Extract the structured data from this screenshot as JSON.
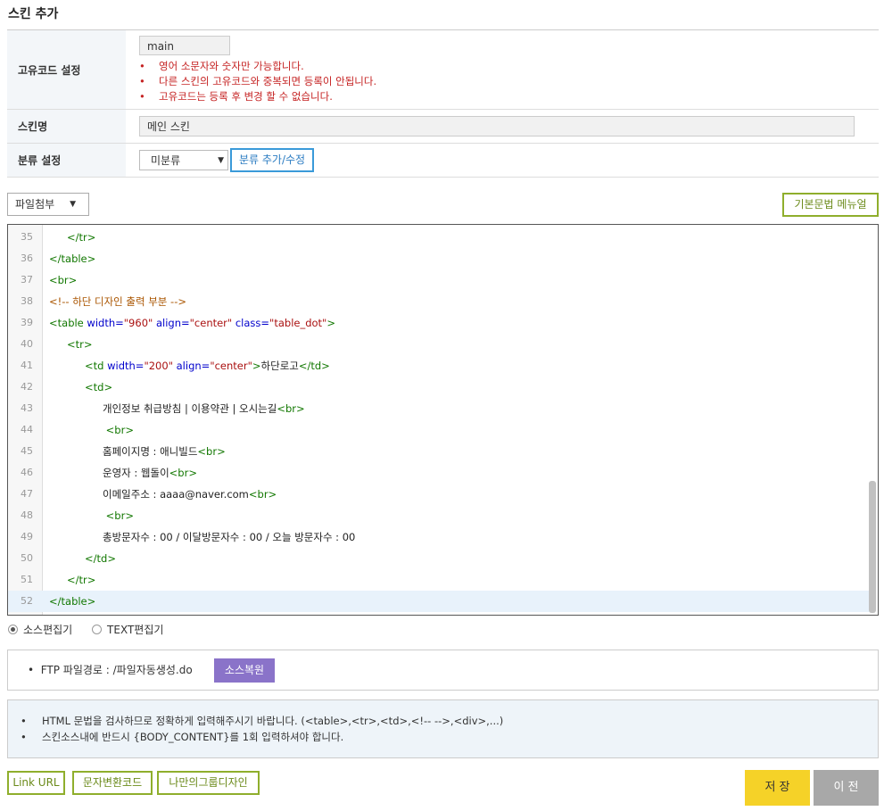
{
  "page_title": "스킨 추가",
  "form": {
    "code_label": "고유코드 설정",
    "code_value": "main",
    "code_notes": [
      "영어 소문자와 숫자만 가능합니다.",
      "다른 스킨의 고유코드와 중복되면 등록이 안됩니다.",
      "고유코드는 등록 후 변경 할 수 없습니다."
    ],
    "name_label": "스킨명",
    "name_value": "메인 스킨",
    "category_label": "분류 설정",
    "category_selected": "미분류",
    "category_button": "분류 추가/수정"
  },
  "toolbar": {
    "attach_label": "파일첨부",
    "manual_button": "기본문법 메뉴얼"
  },
  "editor": {
    "lines": [
      {
        "n": "35",
        "indent": 1,
        "segs": [
          [
            "tg",
            "</tr>"
          ]
        ]
      },
      {
        "n": "36",
        "indent": 0,
        "segs": [
          [
            "tg",
            "</table>"
          ]
        ]
      },
      {
        "n": "37",
        "indent": 0,
        "segs": [
          [
            "tg",
            "<br>"
          ]
        ]
      },
      {
        "n": "38",
        "indent": 0,
        "segs": [
          [
            "cm",
            "<!-- 하단 디자인 출력 부분 -->"
          ]
        ]
      },
      {
        "n": "39",
        "indent": 0,
        "segs": [
          [
            "tg",
            "<table "
          ],
          [
            "at",
            "width="
          ],
          [
            "sv",
            "\"960\""
          ],
          [
            "at",
            " align="
          ],
          [
            "sv",
            "\"center\""
          ],
          [
            "at",
            " class="
          ],
          [
            "sv",
            "\"table_dot\""
          ],
          [
            "tg",
            ">"
          ]
        ]
      },
      {
        "n": "40",
        "indent": 1,
        "segs": [
          [
            "tg",
            "<tr>"
          ]
        ]
      },
      {
        "n": "41",
        "indent": 2,
        "segs": [
          [
            "tg",
            "<td "
          ],
          [
            "at",
            "width="
          ],
          [
            "sv",
            "\"200\""
          ],
          [
            "at",
            " align="
          ],
          [
            "sv",
            "\"center\""
          ],
          [
            "tg",
            ">"
          ],
          [
            "tx",
            "하단로고"
          ],
          [
            "tg",
            "</td>"
          ]
        ]
      },
      {
        "n": "42",
        "indent": 2,
        "segs": [
          [
            "tg",
            "<td>"
          ]
        ]
      },
      {
        "n": "43",
        "indent": 3,
        "segs": [
          [
            "tx",
            "개인정보 취급방침 | 이용약관 | 오시는길"
          ],
          [
            "tg",
            "<br>"
          ]
        ]
      },
      {
        "n": "44",
        "indent": 3,
        "segs": [
          [
            "tx",
            " "
          ],
          [
            "tg",
            "<br>"
          ]
        ]
      },
      {
        "n": "45",
        "indent": 3,
        "segs": [
          [
            "tx",
            "홈페이지명 : 애니빌드"
          ],
          [
            "tg",
            "<br>"
          ]
        ]
      },
      {
        "n": "46",
        "indent": 3,
        "segs": [
          [
            "tx",
            "운영자 : 웹돌이"
          ],
          [
            "tg",
            "<br>"
          ]
        ]
      },
      {
        "n": "47",
        "indent": 3,
        "segs": [
          [
            "tx",
            "이메일주소 : aaaa@naver.com"
          ],
          [
            "tg",
            "<br>"
          ]
        ]
      },
      {
        "n": "48",
        "indent": 3,
        "segs": [
          [
            "tx",
            " "
          ],
          [
            "tg",
            "<br>"
          ]
        ]
      },
      {
        "n": "49",
        "indent": 3,
        "segs": [
          [
            "tx",
            "총방문자수 : 00 / 이달방문자수 : 00 / 오늘 방문자수 : 00"
          ]
        ]
      },
      {
        "n": "50",
        "indent": 2,
        "segs": [
          [
            "tg",
            "</td>"
          ]
        ]
      },
      {
        "n": "51",
        "indent": 1,
        "segs": [
          [
            "tg",
            "</tr>"
          ]
        ]
      },
      {
        "n": "52",
        "indent": 0,
        "segs": [
          [
            "tg",
            "</table>"
          ]
        ],
        "active": true
      }
    ]
  },
  "editor_mode": {
    "source_label": "소스편집기",
    "text_label": "TEXT편집기",
    "selected": "source"
  },
  "ftp": {
    "path_text": "FTP 파일경로 : /파일자동생성.do",
    "restore_button": "소스복원"
  },
  "info": [
    "HTML 문법을 검사하므로 정확하게 입력해주시기 바랍니다. (<table>,<tr>,<td>,<!-- -->,<div>,...)",
    "스킨소스내에 반드시 {BODY_CONTENT}를 1회 입력하셔야 합니다."
  ],
  "bottom": {
    "link_url": "Link URL",
    "char_convert": "문자변환코드",
    "group_design": "나만의그룹디자인",
    "save": "저 장",
    "prev": "이 전"
  },
  "colors": {
    "accent_blue": "#3a9ad9",
    "accent_green": "#8fae2c",
    "save_yellow": "#f5d228",
    "restore_purple": "#8a73c9",
    "warning_red": "#c52222"
  }
}
